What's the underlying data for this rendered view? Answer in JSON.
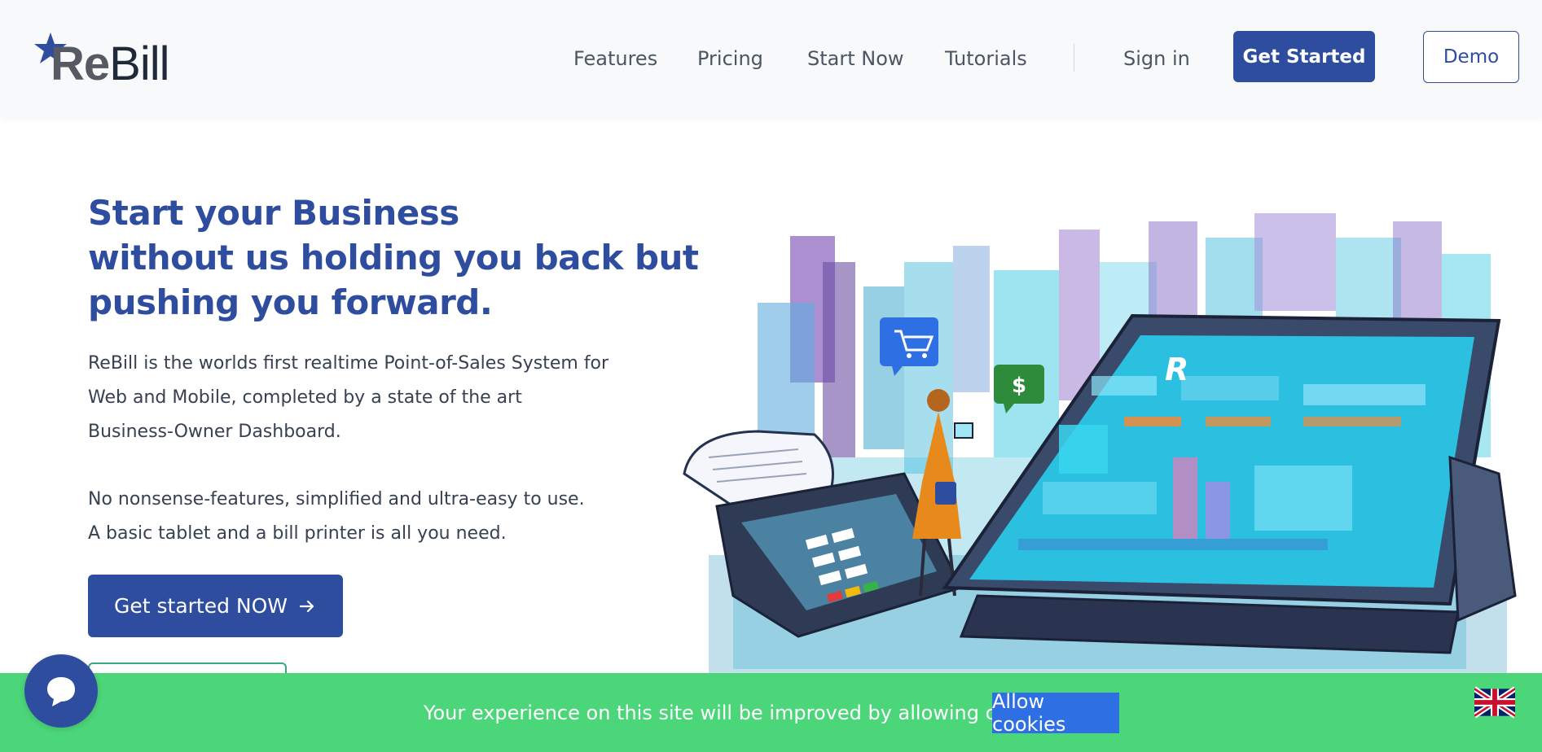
{
  "brand": {
    "re": "Re",
    "bill": "Bill"
  },
  "nav": {
    "items": [
      {
        "label": "Features"
      },
      {
        "label": "Pricing"
      },
      {
        "label": "Start Now"
      },
      {
        "label": "Tutorials"
      }
    ],
    "sign_in": "Sign in",
    "get_started": "Get Started",
    "demo": "Demo"
  },
  "hero": {
    "title_lines": [
      "Start your Business",
      "without us holding you back but",
      "pushing you forward."
    ],
    "description": "ReBill is the worlds first realtime Point-of-Sales System for Web and Mobile, completed by a state of the art Business-Owner Dashboard.",
    "description2_lines": [
      "No nonsense-features, simplified and ultra-easy to use.",
      "A basic tablet and a bill printer is all you need."
    ],
    "cta_label": "Get started NOW",
    "cta_icon": "arrow-right-icon"
  },
  "illustration": {
    "screen_logo": "R",
    "dollar_icon": "$"
  },
  "cookie": {
    "message": "Your experience on this site will be improved by allowing cookies.",
    "button": "Allow cookies",
    "flag_icon": "uk-flag-icon"
  },
  "colors": {
    "brand_blue": "#2f4d9e",
    "cookie_green": "#4cd67a",
    "cookie_button_blue": "#2f6fe4"
  }
}
